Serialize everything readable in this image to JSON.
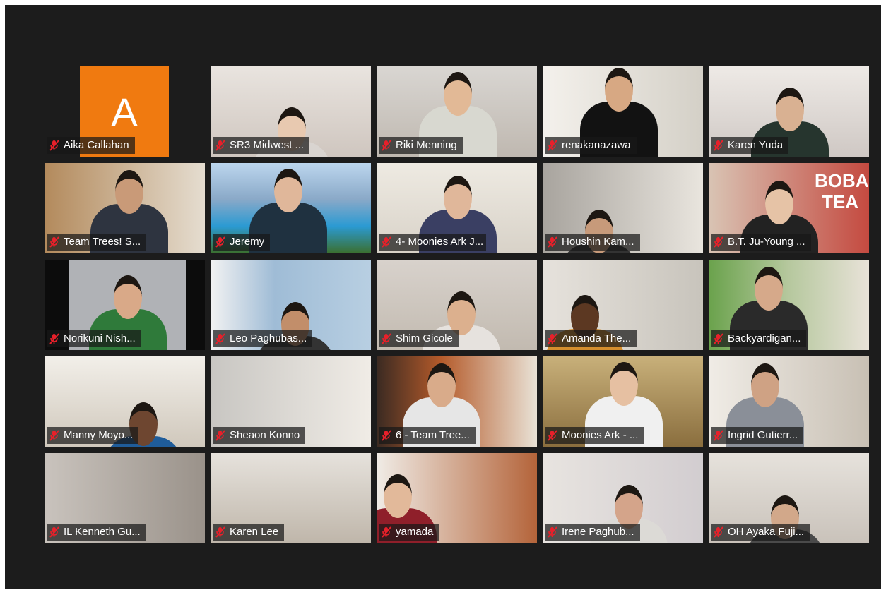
{
  "meeting": {
    "avatar_letter": "A",
    "colors": {
      "avatar": "#f07a10",
      "active_speaker_border": "#d8e63a",
      "muted_mic": "#e8202a"
    },
    "participants": [
      {
        "name": "Aika Callahan"
      },
      {
        "name": "SR3 Midwest ..."
      },
      {
        "name": "Riki Menning"
      },
      {
        "name": "renakanazawa"
      },
      {
        "name": "Karen Yuda"
      },
      {
        "name": "Team Trees! S..."
      },
      {
        "name": "Jeremy"
      },
      {
        "name": "4- Moonies Ark J..."
      },
      {
        "name": "Houshin Kam..."
      },
      {
        "name": "B.T. Ju-Young ..."
      },
      {
        "name": "Norikuni Nish..."
      },
      {
        "name": "Leo Paghubas..."
      },
      {
        "name": "Shim Gicole"
      },
      {
        "name": "Amanda The..."
      },
      {
        "name": "Backyardigan..."
      },
      {
        "name": "Manny Moyo..."
      },
      {
        "name": "Sheaon Konno"
      },
      {
        "name": "6 - Team Tree..."
      },
      {
        "name": "Moonies Ark - ..."
      },
      {
        "name": "Ingrid Gutierr..."
      },
      {
        "name": "IL Kenneth Gu..."
      },
      {
        "name": "Karen Lee"
      },
      {
        "name": "yamada"
      },
      {
        "name": "Irene Paghub..."
      },
      {
        "name": "OH Ayaka Fuji..."
      }
    ],
    "boba_sign": "BOBA TEA"
  }
}
